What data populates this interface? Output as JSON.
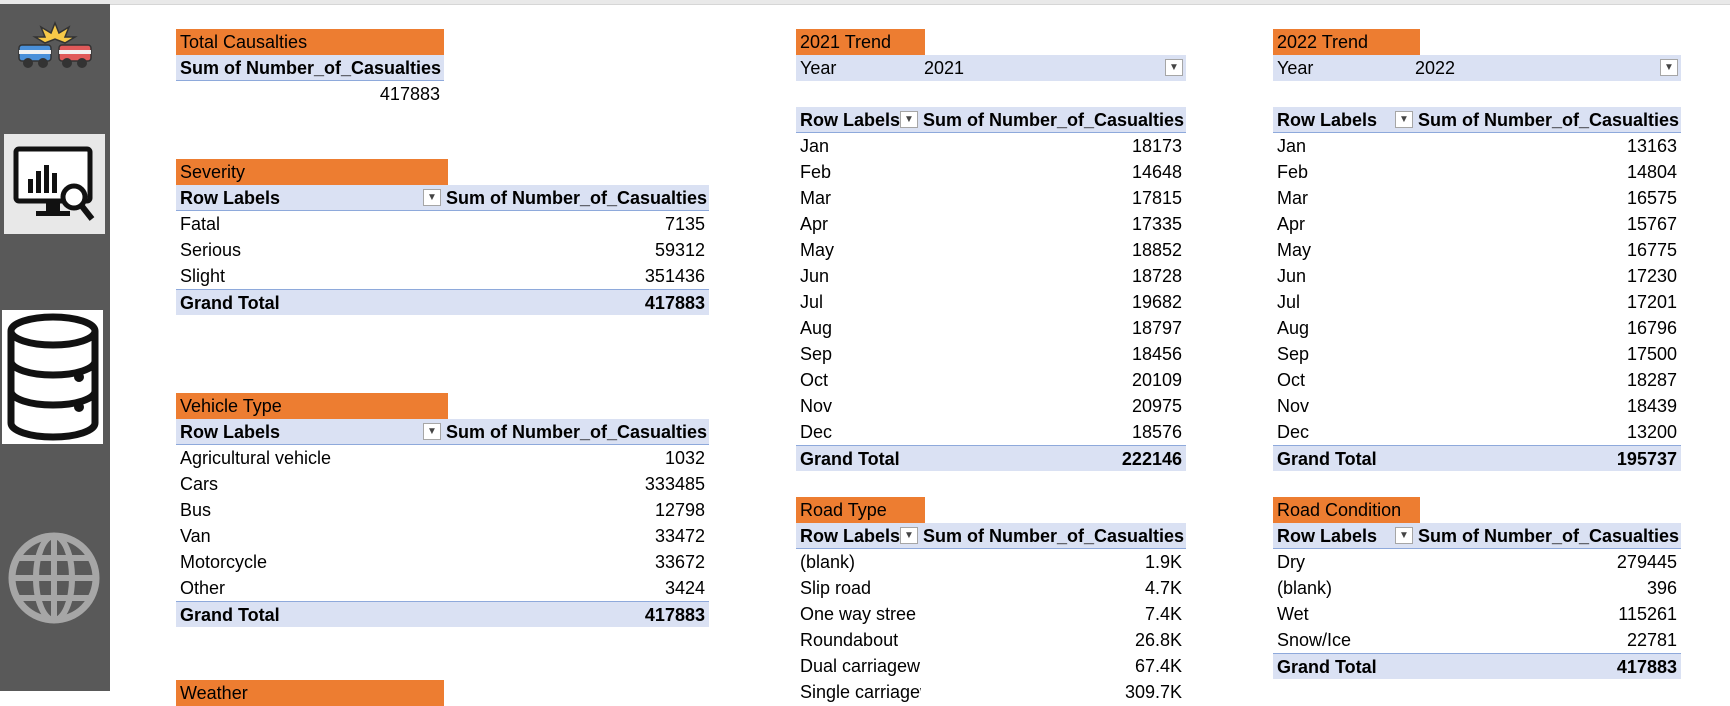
{
  "colors": {
    "title_fill": "#ed7d31",
    "header_fill": "#dae1f3",
    "sidebar": "#595959"
  },
  "sidebar": {
    "icons": [
      "car-crash-icon",
      "dashboard-monitor-icon",
      "database-icon",
      "globe-icon"
    ]
  },
  "total": {
    "title": "Total Causalties",
    "header": "Sum of Number_of_Casualties",
    "value": "417883"
  },
  "severity": {
    "title": "Severity",
    "row_label": "Row Labels",
    "value_label": "Sum of Number_of_Casualties",
    "rows": [
      {
        "label": "Fatal",
        "value": "7135"
      },
      {
        "label": "Serious",
        "value": "59312"
      },
      {
        "label": "Slight",
        "value": "351436"
      }
    ],
    "total_label": "Grand Total",
    "total_value": "417883"
  },
  "vehicle": {
    "title": "Vehicle Type",
    "row_label": "Row Labels",
    "value_label": "Sum of Number_of_Casualties",
    "rows": [
      {
        "label": "Agricultural vehicle",
        "value": "1032"
      },
      {
        "label": "Cars",
        "value": "333485"
      },
      {
        "label": "Bus",
        "value": "12798"
      },
      {
        "label": "Van",
        "value": "33472"
      },
      {
        "label": "Motorcycle",
        "value": "33672"
      },
      {
        "label": "Other",
        "value": "3424"
      }
    ],
    "total_label": "Grand Total",
    "total_value": "417883"
  },
  "weather": {
    "title": "Weather"
  },
  "trend2021": {
    "title": "2021 Trend",
    "filter_label": "Year",
    "filter_value": "2021",
    "row_label": "Row Labels",
    "value_label": "Sum of Number_of_Casualties",
    "rows": [
      {
        "label": "Jan",
        "value": "18173"
      },
      {
        "label": "Feb",
        "value": "14648"
      },
      {
        "label": "Mar",
        "value": "17815"
      },
      {
        "label": "Apr",
        "value": "17335"
      },
      {
        "label": "May",
        "value": "18852"
      },
      {
        "label": "Jun",
        "value": "18728"
      },
      {
        "label": "Jul",
        "value": "19682"
      },
      {
        "label": "Aug",
        "value": "18797"
      },
      {
        "label": "Sep",
        "value": "18456"
      },
      {
        "label": "Oct",
        "value": "20109"
      },
      {
        "label": "Nov",
        "value": "20975"
      },
      {
        "label": "Dec",
        "value": "18576"
      }
    ],
    "total_label": "Grand Total",
    "total_value": "222146"
  },
  "trend2022": {
    "title": "2022 Trend",
    "filter_label": "Year",
    "filter_value": "2022",
    "row_label": "Row Labels",
    "value_label": "Sum of Number_of_Casualties",
    "rows": [
      {
        "label": "Jan",
        "value": "13163"
      },
      {
        "label": "Feb",
        "value": "14804"
      },
      {
        "label": "Mar",
        "value": "16575"
      },
      {
        "label": "Apr",
        "value": "15767"
      },
      {
        "label": "May",
        "value": "16775"
      },
      {
        "label": "Jun",
        "value": "17230"
      },
      {
        "label": "Jul",
        "value": "17201"
      },
      {
        "label": "Aug",
        "value": "16796"
      },
      {
        "label": "Sep",
        "value": "17500"
      },
      {
        "label": "Oct",
        "value": "18287"
      },
      {
        "label": "Nov",
        "value": "18439"
      },
      {
        "label": "Dec",
        "value": "13200"
      }
    ],
    "total_label": "Grand Total",
    "total_value": "195737"
  },
  "roadtype": {
    "title": "Road Type",
    "row_label": "Row Labels",
    "value_label": "Sum of Number_of_Casualties",
    "rows": [
      {
        "label": "(blank)",
        "value": "1.9K"
      },
      {
        "label": "Slip road",
        "value": "4.7K"
      },
      {
        "label": "One way stree",
        "value": "7.4K"
      },
      {
        "label": "Roundabout",
        "value": "26.8K"
      },
      {
        "label": "Dual carriagew",
        "value": "67.4K"
      },
      {
        "label": "Single carriagew",
        "value": "309.7K"
      }
    ]
  },
  "roadcond": {
    "title": "Road Condition",
    "row_label": "Row Labels",
    "value_label": "Sum of Number_of_Casualties",
    "rows": [
      {
        "label": "Dry",
        "value": "279445"
      },
      {
        "label": "(blank)",
        "value": "396"
      },
      {
        "label": "Wet",
        "value": "115261"
      },
      {
        "label": "Snow/Ice",
        "value": "22781"
      }
    ],
    "total_label": "Grand Total",
    "total_value": "417883"
  }
}
